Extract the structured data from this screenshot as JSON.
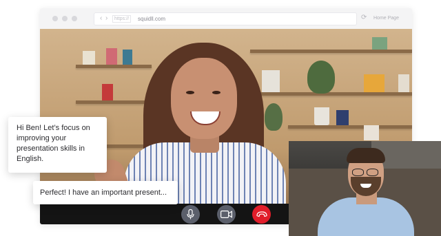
{
  "browser": {
    "protocol": "https://",
    "url": "squidll.com",
    "home_label": "Home Page",
    "nav_back": "‹",
    "nav_forward": "›",
    "reload": "⟳"
  },
  "call": {
    "controls": [
      {
        "name": "microphone-button",
        "icon": "microphone-icon",
        "color": "#5b5f6b"
      },
      {
        "name": "camera-button",
        "icon": "video-camera-icon",
        "color": "#5b5f6b"
      },
      {
        "name": "end-call-button",
        "icon": "hang-up-icon",
        "color": "#e11d2a"
      }
    ]
  },
  "chat": {
    "tutor_message": "Hi Ben! Let’s focus on improving your presentation skills in English.",
    "student_message": "Perfect! I have an important present..."
  },
  "colors": {
    "end_call": "#e11d2a",
    "control_bar": "#141414"
  }
}
